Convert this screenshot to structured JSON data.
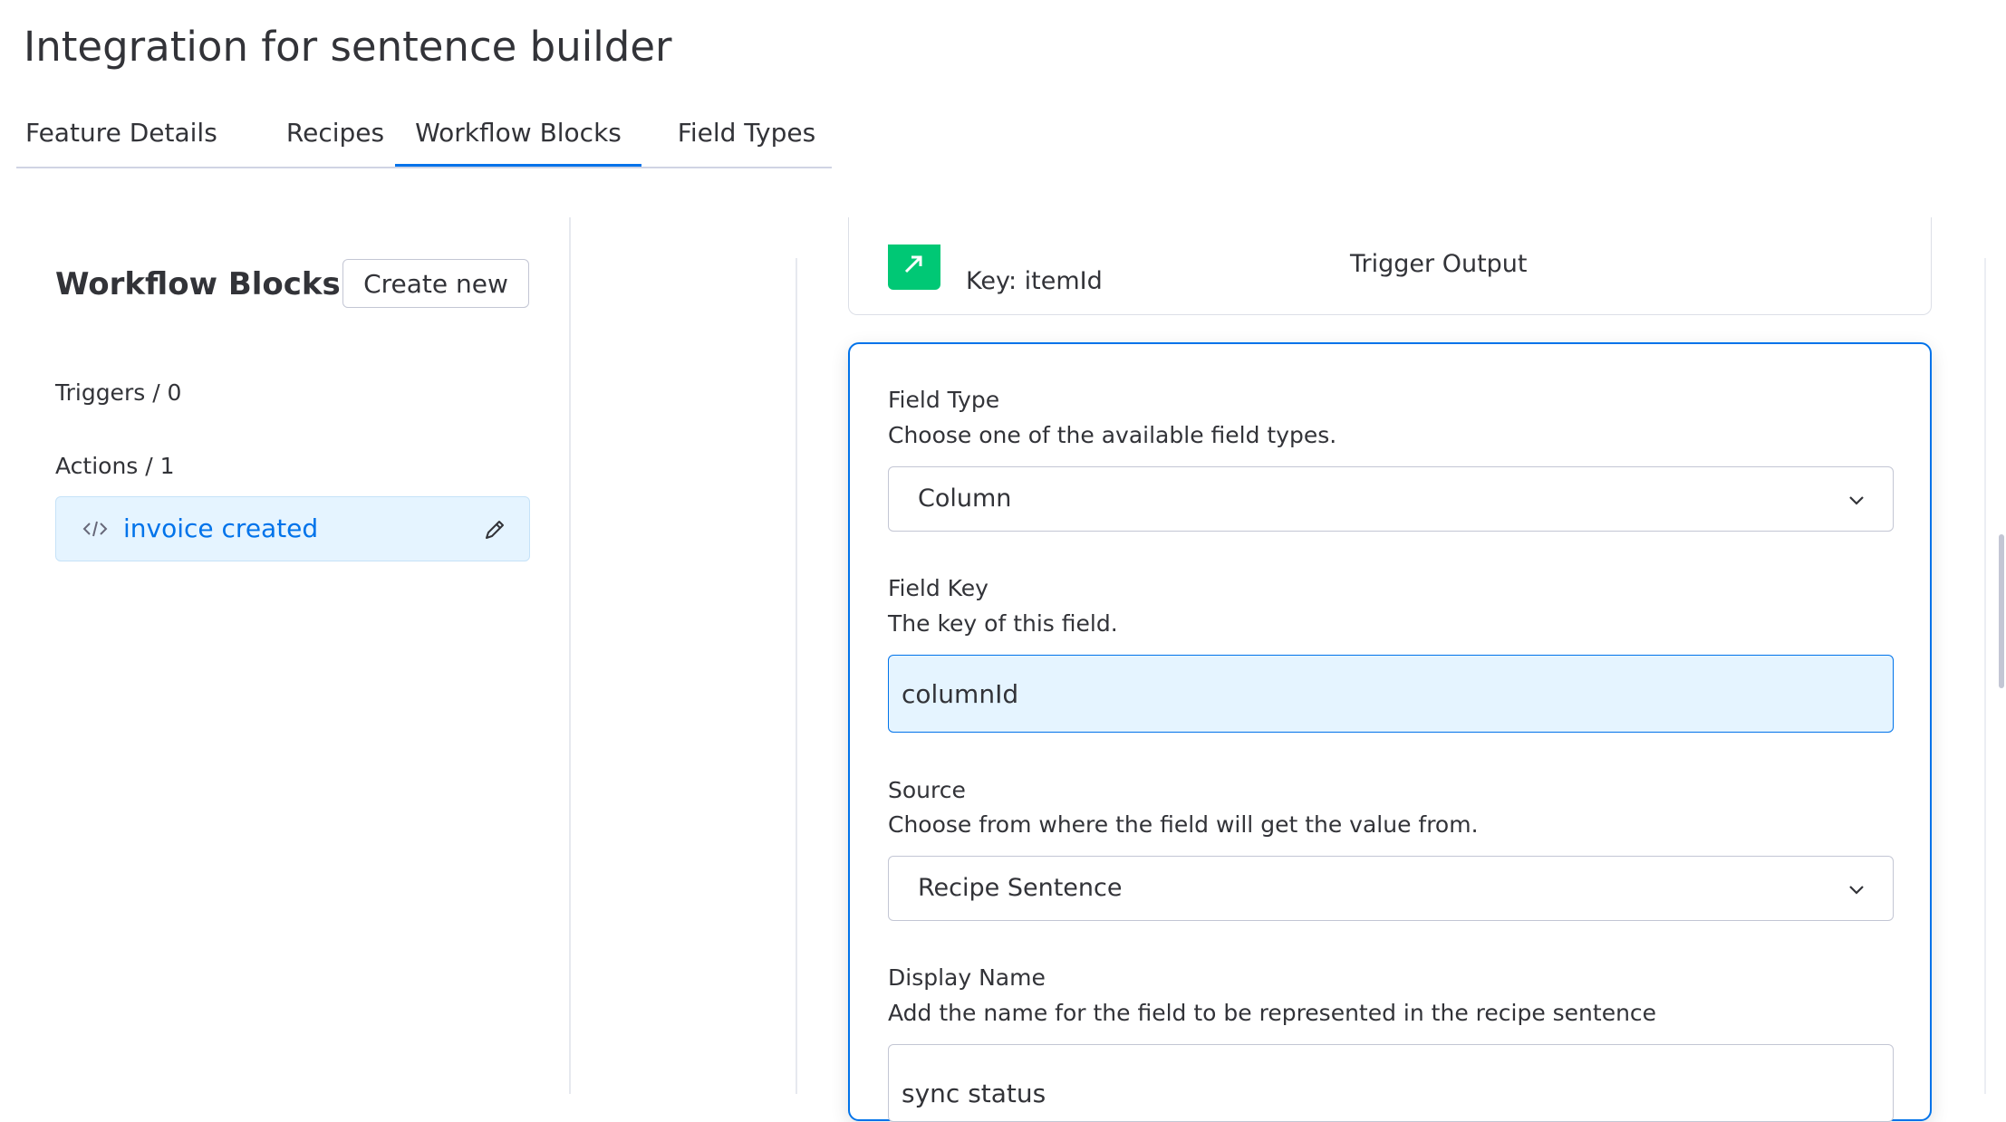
{
  "page": {
    "title": "Integration for sentence builder"
  },
  "tabs": [
    {
      "label": "Feature Details"
    },
    {
      "label": "Recipes"
    },
    {
      "label": "Workflow Blocks"
    },
    {
      "label": "Field Types"
    }
  ],
  "active_tab": "Workflow Blocks",
  "sidebar": {
    "title": "Workflow Blocks",
    "create_label": "Create new",
    "triggers_label": "Triggers / 0",
    "actions_label": "Actions / 1",
    "actions": [
      {
        "label": "invoice created",
        "icon": "code-icon"
      }
    ]
  },
  "output_card": {
    "key_label": "Key: itemId",
    "type_label": "Trigger Output",
    "icon_color": "#00c875"
  },
  "form": {
    "field_type": {
      "label": "Field Type",
      "help": "Choose one of the available field types.",
      "value": "Column"
    },
    "field_key": {
      "label": "Field Key",
      "help": "The key of this field.",
      "value": "columnId"
    },
    "source": {
      "label": "Source",
      "help": "Choose from where the field will get the value from.",
      "value": "Recipe Sentence"
    },
    "display_name": {
      "label": "Display Name",
      "help": "Add the name for the field to be represented in the recipe sentence",
      "value": "sync status"
    }
  },
  "colors": {
    "accent": "#0073ea",
    "selected_bg": "#e5f4ff",
    "text": "#323338"
  }
}
